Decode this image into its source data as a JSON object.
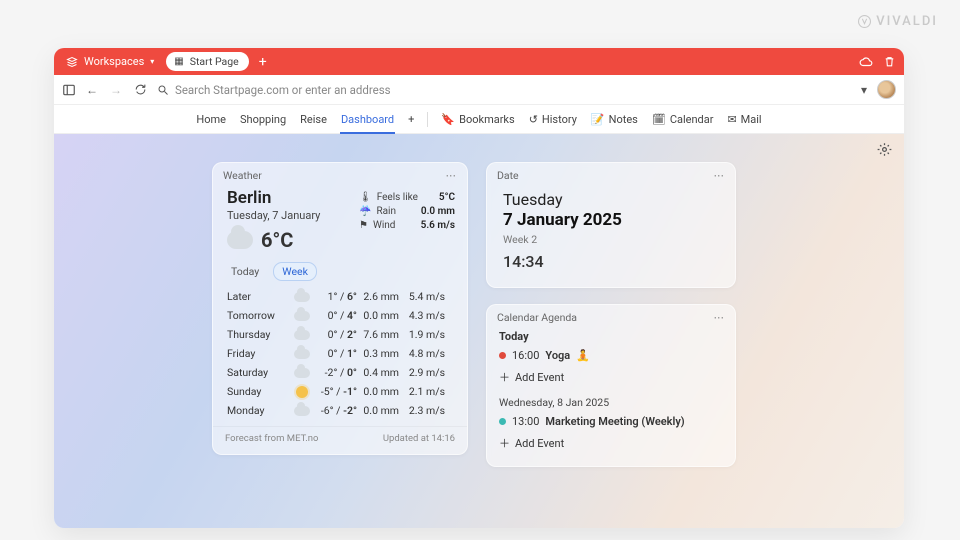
{
  "brand": "VIVALDI",
  "toolbar": {
    "workspaces_label": "Workspaces",
    "tab_title": "Start Page",
    "new_tab": "+"
  },
  "addressbar": {
    "placeholder": "Search Startpage.com or enter an address"
  },
  "nav": {
    "home": "Home",
    "shopping": "Shopping",
    "reise": "Reise",
    "dashboard": "Dashboard",
    "plus": "+",
    "bookmarks": "Bookmarks",
    "history": "History",
    "notes": "Notes",
    "calendar": "Calendar",
    "mail": "Mail"
  },
  "weather": {
    "title": "Weather",
    "city": "Berlin",
    "date": "Tuesday, 7 January",
    "current_temp": "6°C",
    "feels_like_label": "Feels like",
    "feels_like": "5°C",
    "rain_label": "Rain",
    "rain": "0.0 mm",
    "wind_label": "Wind",
    "wind": "5.6 m/s",
    "tab_today": "Today",
    "tab_week": "Week",
    "rows": [
      {
        "day": "Later",
        "icon": "cloud",
        "lo": "1°",
        "hi": "6°",
        "mm": "2.6 mm",
        "ws": "5.4 m/s"
      },
      {
        "day": "Tomorrow",
        "icon": "cloud",
        "lo": "0°",
        "hi": "4°",
        "mm": "0.0 mm",
        "ws": "4.3 m/s"
      },
      {
        "day": "Thursday",
        "icon": "cloud",
        "lo": "0°",
        "hi": "2°",
        "mm": "7.6 mm",
        "ws": "1.9 m/s"
      },
      {
        "day": "Friday",
        "icon": "cloud",
        "lo": "0°",
        "hi": "1°",
        "mm": "0.3 mm",
        "ws": "4.8 m/s"
      },
      {
        "day": "Saturday",
        "icon": "cloud",
        "lo": "-2°",
        "hi": "0°",
        "mm": "0.4 mm",
        "ws": "2.9 m/s"
      },
      {
        "day": "Sunday",
        "icon": "sun",
        "lo": "-5°",
        "hi": "-1°",
        "mm": "0.0 mm",
        "ws": "2.1 m/s"
      },
      {
        "day": "Monday",
        "icon": "cloud",
        "lo": "-6°",
        "hi": "-2°",
        "mm": "0.0 mm",
        "ws": "2.3 m/s"
      }
    ],
    "source": "Forecast from MET.no",
    "updated": "Updated at 14:16"
  },
  "datecard": {
    "title": "Date",
    "weekday": "Tuesday",
    "full": "7 January 2025",
    "week": "Week 2",
    "time": "14:34"
  },
  "agenda": {
    "title": "Calendar Agenda",
    "today_label": "Today",
    "today_events": [
      {
        "time": "16:00",
        "title": "Yoga",
        "emoji": "🧘"
      }
    ],
    "add_event": "Add Event",
    "wed_label": "Wednesday,   8 Jan 2025",
    "wed_events": [
      {
        "time": "13:00",
        "title": "Marketing Meeting (Weekly)"
      }
    ]
  }
}
